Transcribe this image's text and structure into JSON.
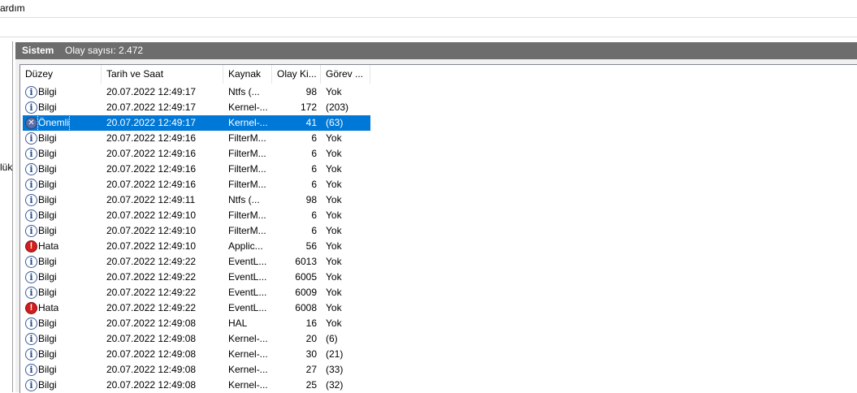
{
  "menu": {
    "help_label": "ardım"
  },
  "left_pane": {
    "partial_label": "lük"
  },
  "header": {
    "title": "Sistem",
    "event_count": "Olay sayısı: 2.472"
  },
  "columns": [
    "Düzey",
    "Tarih ve Saat",
    "Kaynak",
    "Olay Ki...",
    "Görev ..."
  ],
  "rows": [
    {
      "level": "Bilgi",
      "icon": "info-icon",
      "datetime": "20.07.2022 12:49:17",
      "source": "Ntfs (...",
      "event_id": "98",
      "task": "Yok"
    },
    {
      "level": "Bilgi",
      "icon": "info-icon",
      "datetime": "20.07.2022 12:49:17",
      "source": "Kernel-...",
      "event_id": "172",
      "task": "(203)"
    },
    {
      "level": "Önemli",
      "icon": "critical-icon",
      "datetime": "20.07.2022 12:49:17",
      "source": "Kernel-...",
      "event_id": "41",
      "task": "(63)",
      "selected": true
    },
    {
      "level": "Bilgi",
      "icon": "info-icon",
      "datetime": "20.07.2022 12:49:16",
      "source": "FilterM...",
      "event_id": "6",
      "task": "Yok"
    },
    {
      "level": "Bilgi",
      "icon": "info-icon",
      "datetime": "20.07.2022 12:49:16",
      "source": "FilterM...",
      "event_id": "6",
      "task": "Yok"
    },
    {
      "level": "Bilgi",
      "icon": "info-icon",
      "datetime": "20.07.2022 12:49:16",
      "source": "FilterM...",
      "event_id": "6",
      "task": "Yok"
    },
    {
      "level": "Bilgi",
      "icon": "info-icon",
      "datetime": "20.07.2022 12:49:16",
      "source": "FilterM...",
      "event_id": "6",
      "task": "Yok"
    },
    {
      "level": "Bilgi",
      "icon": "info-icon",
      "datetime": "20.07.2022 12:49:11",
      "source": "Ntfs (...",
      "event_id": "98",
      "task": "Yok"
    },
    {
      "level": "Bilgi",
      "icon": "info-icon",
      "datetime": "20.07.2022 12:49:10",
      "source": "FilterM...",
      "event_id": "6",
      "task": "Yok"
    },
    {
      "level": "Bilgi",
      "icon": "info-icon",
      "datetime": "20.07.2022 12:49:10",
      "source": "FilterM...",
      "event_id": "6",
      "task": "Yok"
    },
    {
      "level": "Hata",
      "icon": "error-icon",
      "datetime": "20.07.2022 12:49:10",
      "source": "Applic...",
      "event_id": "56",
      "task": "Yok"
    },
    {
      "level": "Bilgi",
      "icon": "info-icon",
      "datetime": "20.07.2022 12:49:22",
      "source": "EventL...",
      "event_id": "6013",
      "task": "Yok"
    },
    {
      "level": "Bilgi",
      "icon": "info-icon",
      "datetime": "20.07.2022 12:49:22",
      "source": "EventL...",
      "event_id": "6005",
      "task": "Yok"
    },
    {
      "level": "Bilgi",
      "icon": "info-icon",
      "datetime": "20.07.2022 12:49:22",
      "source": "EventL...",
      "event_id": "6009",
      "task": "Yok"
    },
    {
      "level": "Hata",
      "icon": "error-icon",
      "datetime": "20.07.2022 12:49:22",
      "source": "EventL...",
      "event_id": "6008",
      "task": "Yok"
    },
    {
      "level": "Bilgi",
      "icon": "info-icon",
      "datetime": "20.07.2022 12:49:08",
      "source": "HAL",
      "event_id": "16",
      "task": "Yok"
    },
    {
      "level": "Bilgi",
      "icon": "info-icon",
      "datetime": "20.07.2022 12:49:08",
      "source": "Kernel-...",
      "event_id": "20",
      "task": "(6)"
    },
    {
      "level": "Bilgi",
      "icon": "info-icon",
      "datetime": "20.07.2022 12:49:08",
      "source": "Kernel-...",
      "event_id": "30",
      "task": "(21)"
    },
    {
      "level": "Bilgi",
      "icon": "info-icon",
      "datetime": "20.07.2022 12:49:08",
      "source": "Kernel-...",
      "event_id": "27",
      "task": "(33)"
    },
    {
      "level": "Bilgi",
      "icon": "info-icon",
      "datetime": "20.07.2022 12:49:08",
      "source": "Kernel-...",
      "event_id": "25",
      "task": "(32)"
    }
  ],
  "colors": {
    "header_bar": "#6d6d6d",
    "selection": "#0078d7",
    "error": "#d01e1e",
    "info": "#3c5a9a"
  }
}
